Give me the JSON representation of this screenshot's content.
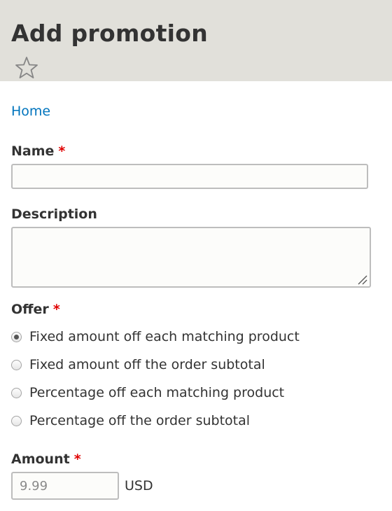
{
  "header": {
    "title": "Add promotion",
    "shortcut_icon": "star-outline-icon"
  },
  "breadcrumb": {
    "home_label": "Home"
  },
  "form": {
    "name": {
      "label": "Name",
      "required_marker": "*",
      "value": ""
    },
    "description": {
      "label": "Description",
      "value": ""
    },
    "offer": {
      "label": "Offer",
      "required_marker": "*",
      "selected_index": 0,
      "options": [
        {
          "label": "Fixed amount off each matching product",
          "checked": true
        },
        {
          "label": "Fixed amount off the order subtotal",
          "checked": false
        },
        {
          "label": "Percentage off each matching product",
          "checked": false
        },
        {
          "label": "Percentage off the order subtotal",
          "checked": false
        }
      ]
    },
    "amount": {
      "label": "Amount",
      "required_marker": "*",
      "value": "",
      "placeholder": "9.99",
      "currency": "USD"
    }
  },
  "colors": {
    "header_background": "#e1e0da",
    "link": "#0074bd",
    "required": "#e00000"
  }
}
